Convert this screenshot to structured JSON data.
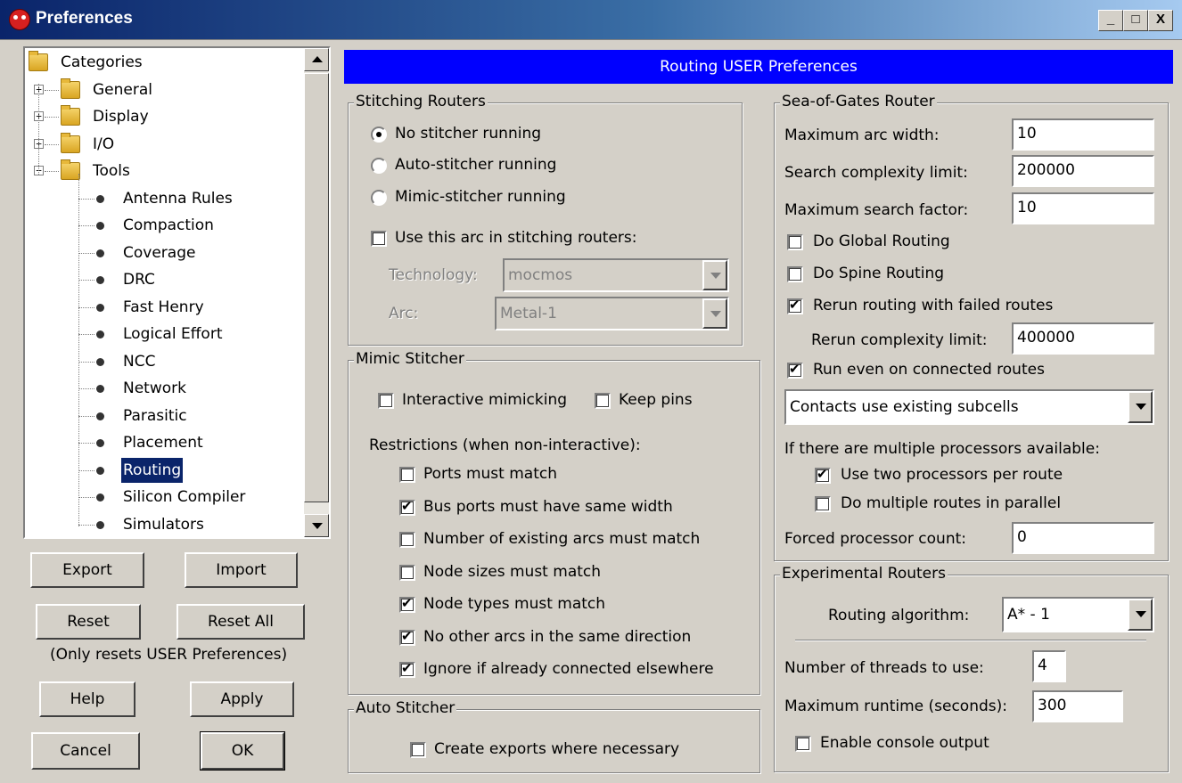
{
  "window": {
    "title": "Preferences",
    "minimize": "_",
    "maximize": "□",
    "close": "X"
  },
  "tree": {
    "root": "Categories",
    "groups": [
      "General",
      "Display",
      "I/O",
      "Tools"
    ],
    "group_expanders": [
      "+",
      "+",
      "+",
      "−"
    ],
    "tools": [
      "Antenna Rules",
      "Compaction",
      "Coverage",
      "DRC",
      "Fast Henry",
      "Logical Effort",
      "NCC",
      "Network",
      "Parasitic",
      "Placement",
      "Routing",
      "Silicon Compiler",
      "Simulators"
    ],
    "selected": "Routing"
  },
  "buttons": {
    "export": "Export",
    "import": "Import",
    "reset": "Reset",
    "reset_all": "Reset All",
    "reset_note": "(Only resets USER Preferences)",
    "help": "Help",
    "apply": "Apply",
    "cancel": "Cancel",
    "ok": "OK"
  },
  "header": {
    "title": "Routing USER Preferences",
    "color": "#0000ff"
  },
  "stitching": {
    "title": "Stitching Routers",
    "radios": [
      "No stitcher running",
      "Auto-stitcher running",
      "Mimic-stitcher running"
    ],
    "selected_radio": 0,
    "use_arc_label": "Use this arc in stitching routers:",
    "use_arc_checked": false,
    "technology_label": "Technology:",
    "technology_value": "mocmos",
    "arc_label": "Arc:",
    "arc_value": "Metal-1"
  },
  "mimic": {
    "title": "Mimic Stitcher",
    "interactive_label": "Interactive mimicking",
    "interactive_checked": false,
    "keep_pins_label": "Keep pins",
    "keep_pins_checked": false,
    "restrictions_label": "Restrictions (when non-interactive):",
    "restrictions": [
      {
        "label": "Ports must match",
        "checked": false
      },
      {
        "label": "Bus ports must have same width",
        "checked": true
      },
      {
        "label": "Number of existing arcs must match",
        "checked": false
      },
      {
        "label": "Node sizes must match",
        "checked": false
      },
      {
        "label": "Node types must match",
        "checked": true
      },
      {
        "label": "No other arcs in the same direction",
        "checked": true
      },
      {
        "label": "Ignore if already connected elsewhere",
        "checked": true
      }
    ]
  },
  "auto": {
    "title": "Auto Stitcher",
    "create_exports_label": "Create exports where necessary",
    "create_exports_checked": false
  },
  "sog": {
    "title": "Sea-of-Gates Router",
    "max_arc_width_label": "Maximum arc width:",
    "max_arc_width": "10",
    "search_complexity_label": "Search complexity limit:",
    "search_complexity": "200000",
    "max_search_factor_label": "Maximum search factor:",
    "max_search_factor": "10",
    "global_routing_label": "Do Global Routing",
    "global_routing_checked": false,
    "spine_routing_label": "Do Spine Routing",
    "spine_routing_checked": false,
    "rerun_label": "Rerun routing with failed routes",
    "rerun_checked": true,
    "rerun_complexity_label": "Rerun complexity limit:",
    "rerun_complexity": "400000",
    "run_connected_label": "Run even on connected routes",
    "run_connected_checked": true,
    "contacts_value": "Contacts use existing subcells",
    "multi_proc_label": "If there are multiple processors available:",
    "two_proc_label": "Use two processors per route",
    "two_proc_checked": true,
    "parallel_label": "Do multiple routes in parallel",
    "parallel_checked": false,
    "forced_count_label": "Forced processor count:",
    "forced_count": "0"
  },
  "experimental": {
    "title": "Experimental Routers",
    "algorithm_label": "Routing algorithm:",
    "algorithm_value": "A* - 1",
    "threads_label": "Number of threads to use:",
    "threads": "4",
    "runtime_label": "Maximum runtime (seconds):",
    "runtime": "300",
    "console_label": "Enable console output",
    "console_checked": false
  }
}
